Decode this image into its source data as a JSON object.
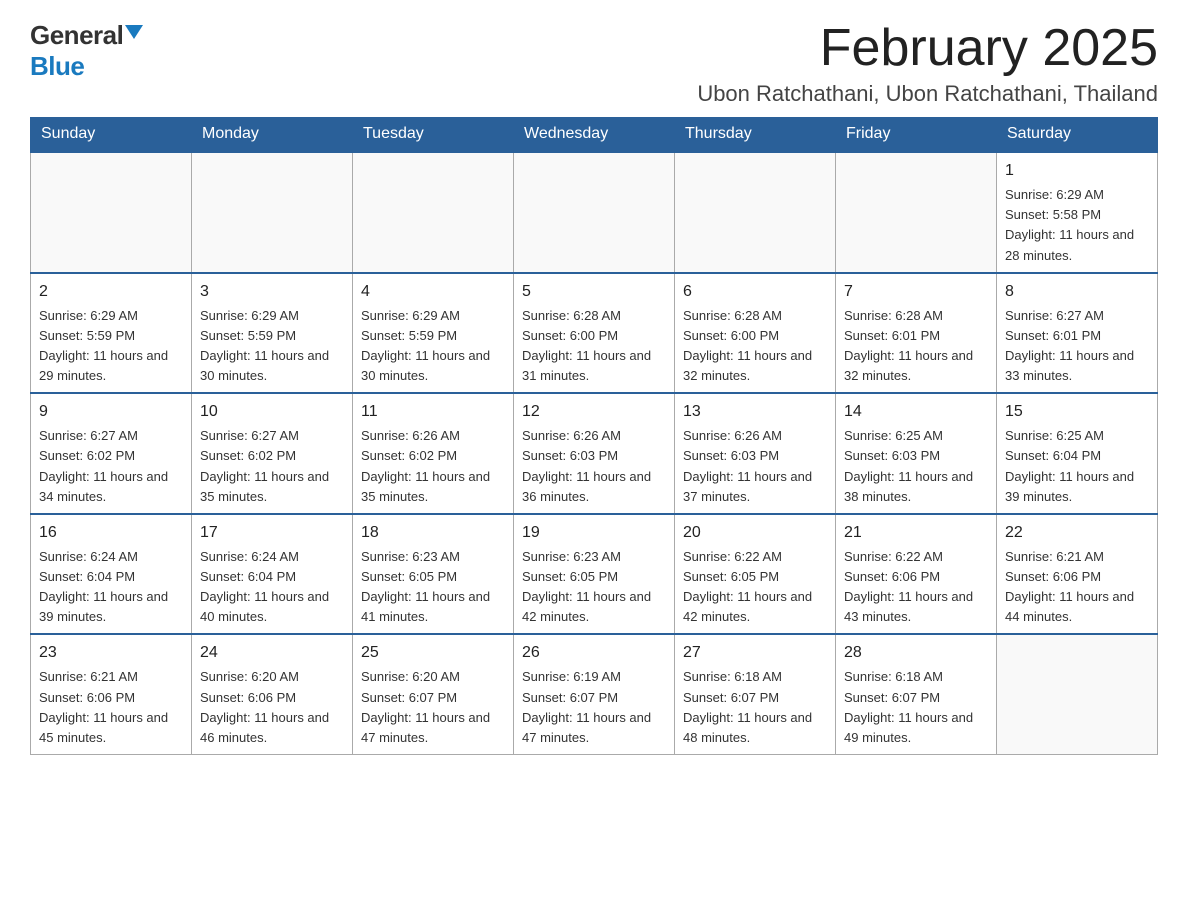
{
  "logo": {
    "general": "General",
    "blue": "Blue"
  },
  "title": "February 2025",
  "location": "Ubon Ratchathani, Ubon Ratchathani, Thailand",
  "weekdays": [
    "Sunday",
    "Monday",
    "Tuesday",
    "Wednesday",
    "Thursday",
    "Friday",
    "Saturday"
  ],
  "weeks": [
    [
      {
        "day": "",
        "info": ""
      },
      {
        "day": "",
        "info": ""
      },
      {
        "day": "",
        "info": ""
      },
      {
        "day": "",
        "info": ""
      },
      {
        "day": "",
        "info": ""
      },
      {
        "day": "",
        "info": ""
      },
      {
        "day": "1",
        "info": "Sunrise: 6:29 AM\nSunset: 5:58 PM\nDaylight: 11 hours and 28 minutes."
      }
    ],
    [
      {
        "day": "2",
        "info": "Sunrise: 6:29 AM\nSunset: 5:59 PM\nDaylight: 11 hours and 29 minutes."
      },
      {
        "day": "3",
        "info": "Sunrise: 6:29 AM\nSunset: 5:59 PM\nDaylight: 11 hours and 30 minutes."
      },
      {
        "day": "4",
        "info": "Sunrise: 6:29 AM\nSunset: 5:59 PM\nDaylight: 11 hours and 30 minutes."
      },
      {
        "day": "5",
        "info": "Sunrise: 6:28 AM\nSunset: 6:00 PM\nDaylight: 11 hours and 31 minutes."
      },
      {
        "day": "6",
        "info": "Sunrise: 6:28 AM\nSunset: 6:00 PM\nDaylight: 11 hours and 32 minutes."
      },
      {
        "day": "7",
        "info": "Sunrise: 6:28 AM\nSunset: 6:01 PM\nDaylight: 11 hours and 32 minutes."
      },
      {
        "day": "8",
        "info": "Sunrise: 6:27 AM\nSunset: 6:01 PM\nDaylight: 11 hours and 33 minutes."
      }
    ],
    [
      {
        "day": "9",
        "info": "Sunrise: 6:27 AM\nSunset: 6:02 PM\nDaylight: 11 hours and 34 minutes."
      },
      {
        "day": "10",
        "info": "Sunrise: 6:27 AM\nSunset: 6:02 PM\nDaylight: 11 hours and 35 minutes."
      },
      {
        "day": "11",
        "info": "Sunrise: 6:26 AM\nSunset: 6:02 PM\nDaylight: 11 hours and 35 minutes."
      },
      {
        "day": "12",
        "info": "Sunrise: 6:26 AM\nSunset: 6:03 PM\nDaylight: 11 hours and 36 minutes."
      },
      {
        "day": "13",
        "info": "Sunrise: 6:26 AM\nSunset: 6:03 PM\nDaylight: 11 hours and 37 minutes."
      },
      {
        "day": "14",
        "info": "Sunrise: 6:25 AM\nSunset: 6:03 PM\nDaylight: 11 hours and 38 minutes."
      },
      {
        "day": "15",
        "info": "Sunrise: 6:25 AM\nSunset: 6:04 PM\nDaylight: 11 hours and 39 minutes."
      }
    ],
    [
      {
        "day": "16",
        "info": "Sunrise: 6:24 AM\nSunset: 6:04 PM\nDaylight: 11 hours and 39 minutes."
      },
      {
        "day": "17",
        "info": "Sunrise: 6:24 AM\nSunset: 6:04 PM\nDaylight: 11 hours and 40 minutes."
      },
      {
        "day": "18",
        "info": "Sunrise: 6:23 AM\nSunset: 6:05 PM\nDaylight: 11 hours and 41 minutes."
      },
      {
        "day": "19",
        "info": "Sunrise: 6:23 AM\nSunset: 6:05 PM\nDaylight: 11 hours and 42 minutes."
      },
      {
        "day": "20",
        "info": "Sunrise: 6:22 AM\nSunset: 6:05 PM\nDaylight: 11 hours and 42 minutes."
      },
      {
        "day": "21",
        "info": "Sunrise: 6:22 AM\nSunset: 6:06 PM\nDaylight: 11 hours and 43 minutes."
      },
      {
        "day": "22",
        "info": "Sunrise: 6:21 AM\nSunset: 6:06 PM\nDaylight: 11 hours and 44 minutes."
      }
    ],
    [
      {
        "day": "23",
        "info": "Sunrise: 6:21 AM\nSunset: 6:06 PM\nDaylight: 11 hours and 45 minutes."
      },
      {
        "day": "24",
        "info": "Sunrise: 6:20 AM\nSunset: 6:06 PM\nDaylight: 11 hours and 46 minutes."
      },
      {
        "day": "25",
        "info": "Sunrise: 6:20 AM\nSunset: 6:07 PM\nDaylight: 11 hours and 47 minutes."
      },
      {
        "day": "26",
        "info": "Sunrise: 6:19 AM\nSunset: 6:07 PM\nDaylight: 11 hours and 47 minutes."
      },
      {
        "day": "27",
        "info": "Sunrise: 6:18 AM\nSunset: 6:07 PM\nDaylight: 11 hours and 48 minutes."
      },
      {
        "day": "28",
        "info": "Sunrise: 6:18 AM\nSunset: 6:07 PM\nDaylight: 11 hours and 49 minutes."
      },
      {
        "day": "",
        "info": ""
      }
    ]
  ]
}
